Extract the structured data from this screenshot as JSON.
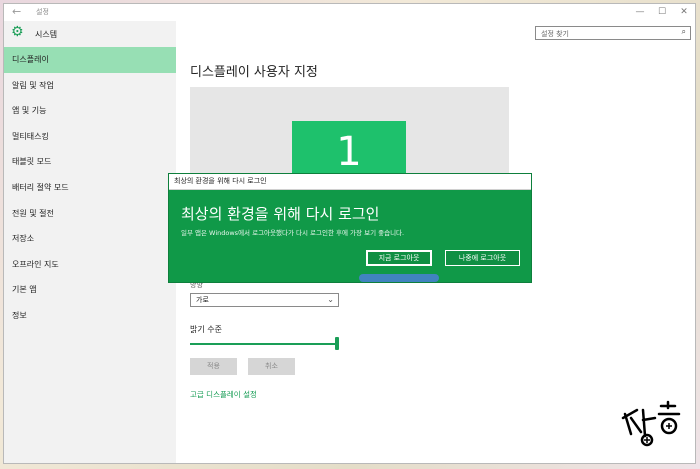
{
  "window": {
    "title": "설정"
  },
  "window_controls": {
    "minimize": "—",
    "maximize": "☐",
    "close": "✕"
  },
  "sidebar": {
    "header": "시스템",
    "items": [
      {
        "label": "디스플레이",
        "selected": true
      },
      {
        "label": "알림 및 작업"
      },
      {
        "label": "앱 및 기능"
      },
      {
        "label": "멀티태스킹"
      },
      {
        "label": "태블릿 모드"
      },
      {
        "label": "배터리 절약 모드"
      },
      {
        "label": "전원 및 절전"
      },
      {
        "label": "저장소"
      },
      {
        "label": "오프라인 지도"
      },
      {
        "label": "기본 앱"
      },
      {
        "label": "정보"
      }
    ]
  },
  "search": {
    "placeholder": "설정 찾기",
    "icon": "search-icon"
  },
  "main": {
    "title": "디스플레이 사용자 지정",
    "monitor_number": "1",
    "orientation_label": "방향",
    "orientation_value": "가로",
    "brightness_label": "밝기 수준",
    "brightness_level": 1.0,
    "apply_label": "적용",
    "cancel_label": "취소",
    "advanced_link": "고급 디스플레이 설정"
  },
  "dialog": {
    "title": "최상의 환경을 위해 다시 로그인",
    "heading": "최상의 환경을 위해 다시 로그인",
    "message": "일부 앱은 Windows에서 로그아웃했다가 다시 로그인한 후에 가장 보기 좋습니다.",
    "signout_now": "지금 로그아웃",
    "signout_later": "나중에 로그아웃"
  },
  "colors": {
    "accent": "#1a9e57",
    "dialog_bg": "#109948",
    "selected_nav": "#97dfb4",
    "monitor": "#1ec16c"
  }
}
